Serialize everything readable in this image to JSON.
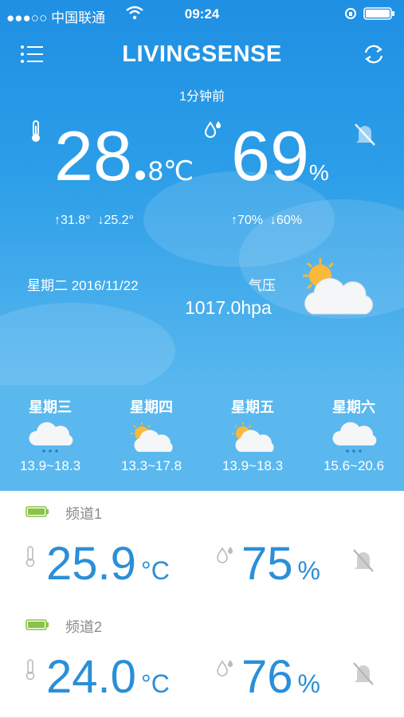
{
  "status_bar": {
    "carrier": "●●●○○ 中国联通",
    "time": "09:24",
    "battery_icon": "battery-icon"
  },
  "navbar": {
    "title": "LIVINGSENSE",
    "menu_icon": "menu-icon",
    "refresh_icon": "refresh-icon"
  },
  "current": {
    "updated": "1分钟前",
    "temp_int": "28",
    "temp_dec": "8",
    "temp_unit": "℃",
    "humidity": "69",
    "humidity_unit": "%",
    "temp_max": "↑31.8°",
    "temp_min": "↓25.2°",
    "hum_max": "↑70%",
    "hum_min": "↓60%",
    "date": "星期二 2016/11/22",
    "pressure_label": "气压",
    "pressure": "1017.0hpa",
    "weather_icon": "partly-cloudy-icon"
  },
  "forecast": [
    {
      "day": "星期三",
      "range": "13.9~18.3",
      "icon": "rain-cloud-icon"
    },
    {
      "day": "星期四",
      "range": "13.3~17.8",
      "icon": "partly-cloudy-icon"
    },
    {
      "day": "星期五",
      "range": "13.9~18.3",
      "icon": "partly-cloudy-icon"
    },
    {
      "day": "星期六",
      "range": "15.6~20.6",
      "icon": "rain-cloud-icon"
    }
  ],
  "channels": [
    {
      "name": "频道1",
      "temp": "25.9",
      "temp_unit": "°C",
      "humidity": "75",
      "humidity_unit": "%"
    },
    {
      "name": "频道2",
      "temp": "24.0",
      "temp_unit": "°C",
      "humidity": "76",
      "humidity_unit": "%"
    }
  ],
  "colors": {
    "primary": "#1f8fe3",
    "value_blue": "#2a8fd8",
    "battery_green": "#8bc34a"
  }
}
